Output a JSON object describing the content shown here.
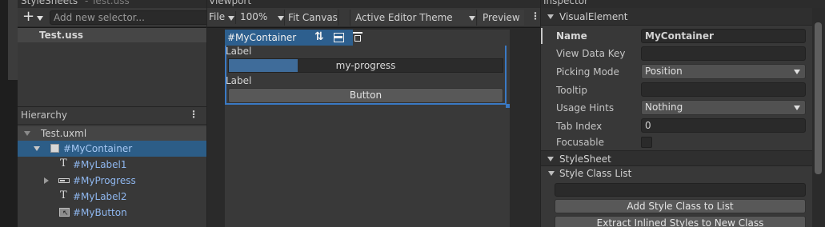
{
  "stylesheets_panel": {
    "title": "StyleSheets",
    "subtitle": "- Test.uss",
    "selector_placeholder": "Add new selector...",
    "selector_more": "⋮",
    "item": "Test.uss"
  },
  "hierarchy_panel": {
    "title": "Hierarchy",
    "more": "⋮",
    "root": "Test.uxml",
    "items": [
      {
        "label": "#MyContainer"
      },
      {
        "label": "#MyLabel1"
      },
      {
        "label": "#MyProgress"
      },
      {
        "label": "#MyLabel2"
      },
      {
        "label": "#MyButton"
      }
    ]
  },
  "viewport_panel": {
    "title": "Viewport",
    "file_menu": "File",
    "zoom": "100%",
    "fit_canvas": "Fit Canvas",
    "theme": "Active Editor Theme",
    "preview": "Preview",
    "more": "⋮",
    "container_tag": "#MyContainer",
    "label1": "Label",
    "progress_title": "my-progress",
    "progress_value": 0.25,
    "label2": "Label",
    "button": "Button"
  },
  "inspector_panel": {
    "title": "Inspector",
    "visual_element_section": "VisualElement",
    "fields": {
      "name_label": "Name",
      "name_value": "MyContainer",
      "view_data_key_label": "View Data Key",
      "view_data_key_value": "",
      "picking_mode_label": "Picking Mode",
      "picking_mode_value": "Position",
      "tooltip_label": "Tooltip",
      "tooltip_value": "",
      "usage_hints_label": "Usage Hints",
      "usage_hints_value": "Nothing",
      "tab_index_label": "Tab Index",
      "tab_index_value": "0",
      "focusable_label": "Focusable"
    },
    "stylesheet_section": "StyleSheet",
    "style_class_list": "Style Class List",
    "add_class_button": "Add Style Class to List",
    "extract_button": "Extract Inlined Styles to New Class"
  },
  "colors": {
    "selection": "#2c5d87",
    "progress_fill": "#3f6c9a",
    "link_text": "#8fb7ef"
  }
}
